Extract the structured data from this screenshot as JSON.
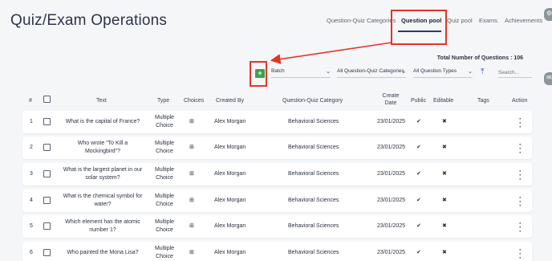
{
  "page": {
    "title": "Quiz/Exam Operations"
  },
  "nav": {
    "items": [
      "Question-Quiz Categories",
      "Question pool",
      "Quiz pool",
      "Exams",
      "Achievements"
    ],
    "active": "Question pool"
  },
  "toolbar": {
    "total_label": "Total Number of Questions : 106",
    "add_symbol": "+",
    "batch_label": "Batch",
    "category_filter_label": "All Question-Quiz Categories",
    "type_filter_label": "All Question Types",
    "search_placeholder": "Search..."
  },
  "table": {
    "headers": {
      "index": "#",
      "text": "Text",
      "type": "Type",
      "choices": "Choices",
      "created_by": "Created By",
      "category": "Question-Quiz Category",
      "create_date_1": "Create",
      "create_date_2": "Date",
      "public": "Public",
      "editable": "Editable",
      "tags": "Tags",
      "action": "Action"
    },
    "rows": [
      {
        "n": "1",
        "text_1": "What is the capital of France?",
        "text_2": "",
        "type_1": "Multiple",
        "type_2": "Choice",
        "created_by": "Alex Morgan",
        "category": "Behavioral Sciences",
        "date": "23/01/2025",
        "public": "✔",
        "editable": "✖"
      },
      {
        "n": "2",
        "text_1": "Who wrote \"To Kill a",
        "text_2": "Mockingbird\"?",
        "type_1": "Multiple",
        "type_2": "Choice",
        "created_by": "Alex Morgan",
        "category": "Behavioral Sciences",
        "date": "23/01/2025",
        "public": "✔",
        "editable": "✖"
      },
      {
        "n": "3",
        "text_1": "What is the largest planet in our",
        "text_2": "solar system?",
        "type_1": "Multiple",
        "type_2": "Choice",
        "created_by": "Alex Morgan",
        "category": "Behavioral Sciences",
        "date": "23/01/2025",
        "public": "✔",
        "editable": "✖"
      },
      {
        "n": "4",
        "text_1": "What is the chemical symbol for",
        "text_2": "water?",
        "type_1": "Multiple",
        "type_2": "Choice",
        "created_by": "Alex Morgan",
        "category": "Behavioral Sciences",
        "date": "23/01/2025",
        "public": "✔",
        "editable": "✖"
      },
      {
        "n": "5",
        "text_1": "Which element has the atomic",
        "text_2": "number 1?",
        "type_1": "Multiple",
        "type_2": "Choice",
        "created_by": "Alex Morgan",
        "category": "Behavioral Sciences",
        "date": "23/01/2025",
        "public": "✔",
        "editable": "✖"
      },
      {
        "n": "6",
        "text_1": "Who painted the Mona Lisa?",
        "text_2": "",
        "type_1": "Multiple",
        "type_2": "Choice",
        "created_by": "Alex Morgan",
        "category": "Behavioral Sciences",
        "date": "23/01/2025",
        "public": "✔",
        "editable": "✖"
      }
    ]
  },
  "colors": {
    "annotation": "#e53424",
    "add_button": "#3ea04b",
    "nav_underline": "#2b3a67",
    "background": "#f5f6f8"
  }
}
